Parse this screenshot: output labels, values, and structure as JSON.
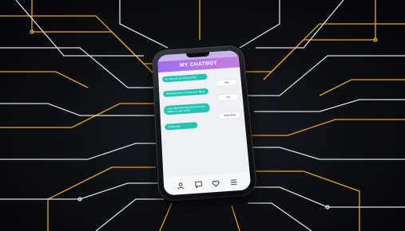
{
  "app": {
    "title": "MY CHATBOT"
  },
  "colors": {
    "header_start": "#9f6df0",
    "header_end": "#c77ed9",
    "bot_bubble": "#22c3b4",
    "user_bubble": "#ffffff",
    "circuit_gold": "#e0a530",
    "circuit_white": "#d8dbe0"
  },
  "messages": [
    {
      "role": "bot",
      "text": "Hi, how are you doing today?",
      "time": ""
    },
    {
      "role": "user",
      "text": "Fine",
      "time": ""
    },
    {
      "role": "bot",
      "text": "Would you like to know more about",
      "time": ""
    },
    {
      "role": "user",
      "text": "Ok",
      "time": ""
    },
    {
      "role": "bot",
      "text": "I can recommend products for you based on your needs",
      "time": ""
    },
    {
      "role": "user",
      "text": "Great idea",
      "time": ""
    },
    {
      "role": "bot",
      "text": "Thank you!",
      "time": ""
    }
  ],
  "nav": {
    "icons": [
      "user-icon",
      "chat-icon",
      "heart-icon",
      "menu-icon"
    ]
  }
}
